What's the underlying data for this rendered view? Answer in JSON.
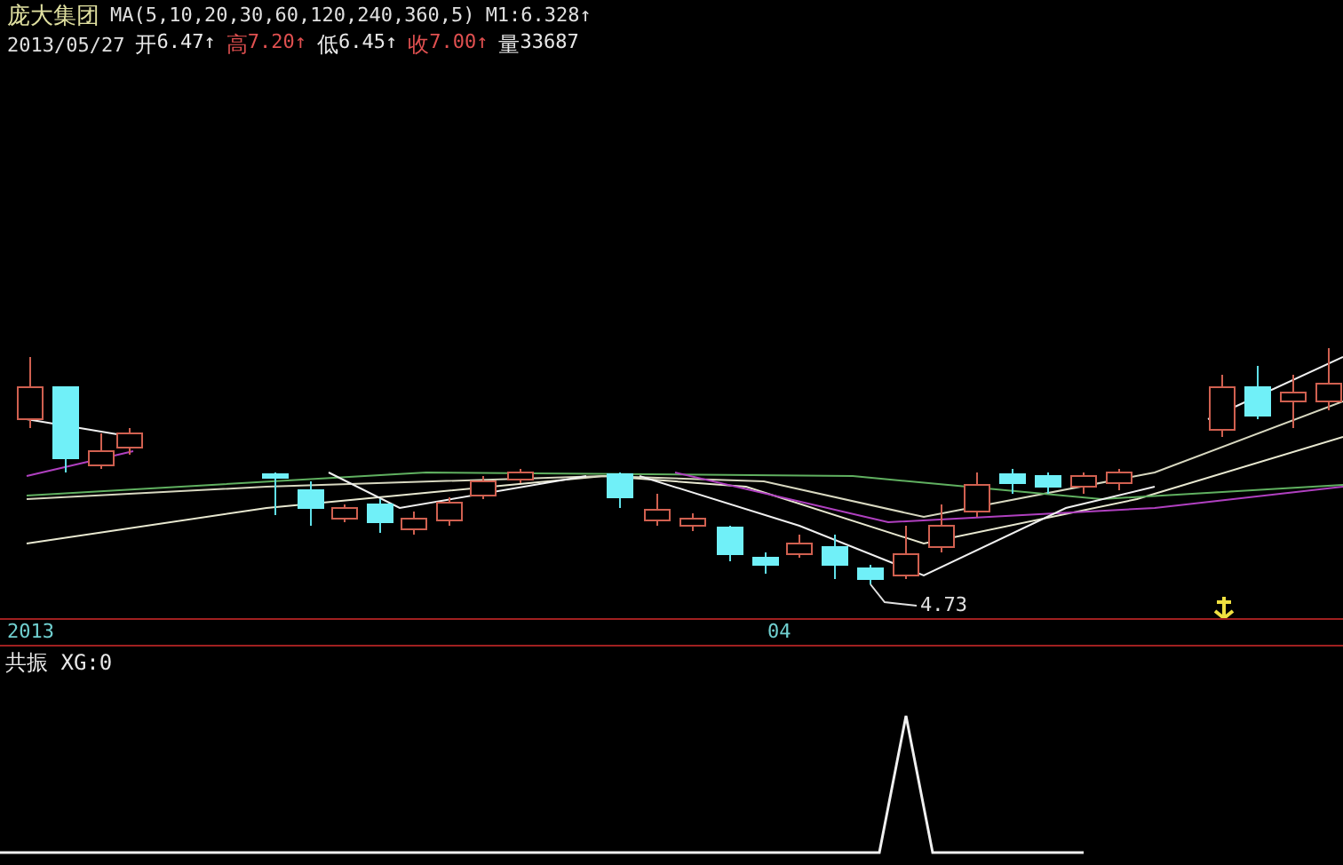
{
  "header": {
    "stock_name": "庞大集团",
    "ma_params": "MA(5,10,20,30,60,120,240,360,5)",
    "ma_value": "M1:6.328↑"
  },
  "quote": {
    "date": "2013/05/27",
    "items": [
      {
        "label": "开",
        "value": "6.47↑",
        "color": "#e8e8e8"
      },
      {
        "label": "高",
        "value": "7.20↑",
        "color": "#e05050"
      },
      {
        "label": "低",
        "value": "6.45↑",
        "color": "#e8e8e8"
      },
      {
        "label": "收",
        "value": "7.00↑",
        "color": "#e05050"
      },
      {
        "label": "量",
        "value": "33687",
        "color": "#e8e8e8"
      }
    ]
  },
  "main_chart": {
    "low_label": "4.73"
  },
  "time_axis": {
    "labels": [
      "2013",
      "04"
    ]
  },
  "indicator": {
    "title": "共振 XG:0"
  }
}
